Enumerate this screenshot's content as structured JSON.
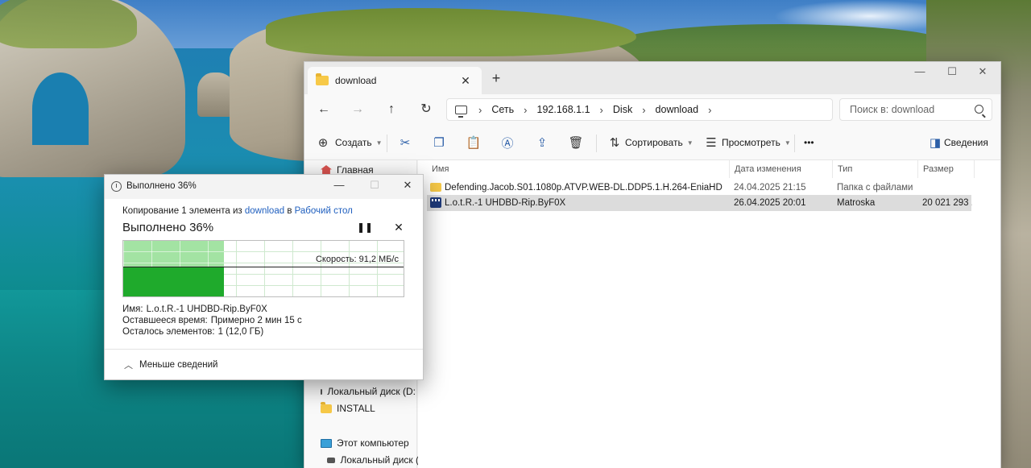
{
  "explorer": {
    "tab_title": "download",
    "breadcrumb": [
      "Сеть",
      "192.168.1.1",
      "Disk",
      "download"
    ],
    "search_placeholder": "Поиск в: download",
    "toolbar": {
      "create": "Создать",
      "sort": "Сортировать",
      "view": "Просмотреть",
      "more": "•••",
      "details": "Сведения"
    },
    "sidebar": {
      "home": "Главная",
      "local_d": "Локальный диск (D:",
      "install": "INSTALL",
      "this_pc": "Этот компьютер",
      "local_c": "Локальный диск (("
    },
    "columns": {
      "name": "Имя",
      "date": "Дата изменения",
      "type": "Тип",
      "size": "Размер"
    },
    "files": [
      {
        "name": "Defending.Jacob.S01.1080p.ATVP.WEB-DL.DDP5.1.H.264-EniaHD",
        "date": "24.04.2025 21:15",
        "type": "Папка с файлами",
        "size": "",
        "icon": "folder-icon",
        "selected": false
      },
      {
        "name": "L.o.t.R.-1 UHDBD-Rip.ByF0X",
        "date": "26.04.2025 20:01",
        "type": "Matroska",
        "size": "20 021 293 ...",
        "icon": "video-file-icon",
        "selected": true
      }
    ]
  },
  "copy_dialog": {
    "title": "Выполнено 36%",
    "copy_prefix": "Копирование 1 элемента из",
    "source": "download",
    "copy_mid": "в",
    "destination": "Рабочий стол",
    "progress_text": "Выполнено 36%",
    "progress_fraction": 0.36,
    "speed_label": "Скорость: 91,2 МБ/с",
    "speed_level_fraction": 0.54,
    "name_label": "Имя:",
    "name_value": "L.o.t.R.-1 UHDBD-Rip.ByF0X",
    "time_label": "Оставшееся время:",
    "time_value": "Примерно 2 мин 15 с",
    "items_label": "Осталось элементов:",
    "items_value": "1 (12,0 ГБ)",
    "less_details": "Меньше сведений"
  },
  "colors": {
    "accent_link": "#1f5fbf",
    "graph_light": "#8cdc8c",
    "graph_dark": "#1faa2c"
  }
}
